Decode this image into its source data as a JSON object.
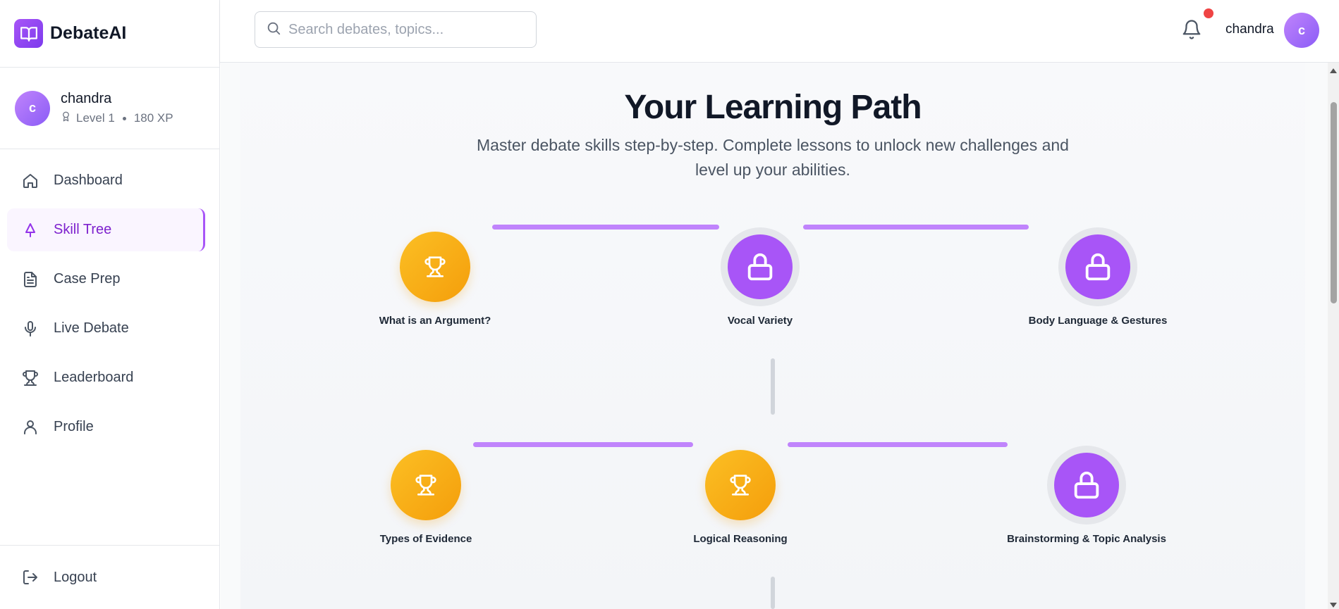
{
  "app": {
    "name": "DebateAI",
    "logo_icon": "book-open-icon",
    "accent": "#a855f7"
  },
  "user": {
    "name": "chandra",
    "initial": "c",
    "level": "Level 1",
    "xp": "180 XP"
  },
  "nav": {
    "items": [
      {
        "label": "Dashboard",
        "icon": "home-icon"
      },
      {
        "label": "Skill Tree",
        "icon": "tree-icon",
        "active": true
      },
      {
        "label": "Case Prep",
        "icon": "document-icon"
      },
      {
        "label": "Live Debate",
        "icon": "microphone-icon"
      },
      {
        "label": "Leaderboard",
        "icon": "trophy-icon"
      },
      {
        "label": "Profile",
        "icon": "user-icon"
      }
    ],
    "logout": "Logout"
  },
  "topbar": {
    "search_placeholder": "Search debates, topics...",
    "username": "chandra",
    "initial": "c",
    "notification_dot_color": "#ef4444"
  },
  "main": {
    "title": "Your Learning Path",
    "subtitle": "Master debate skills step-by-step. Complete lessons to unlock new challenges and level up your abilities.",
    "nodes": [
      {
        "label": "What is an Argument?",
        "status": "completed",
        "icon": "trophy-icon"
      },
      {
        "label": "Vocal Variety",
        "status": "locked",
        "icon": "lock-icon"
      },
      {
        "label": "Body Language & Gestures",
        "status": "locked",
        "icon": "lock-icon"
      },
      {
        "label": "Types of Evidence",
        "status": "completed",
        "icon": "trophy-icon"
      },
      {
        "label": "Logical Reasoning",
        "status": "completed",
        "icon": "trophy-icon"
      },
      {
        "label": "Brainstorming & Topic Analysis",
        "status": "locked",
        "icon": "lock-icon"
      }
    ]
  }
}
